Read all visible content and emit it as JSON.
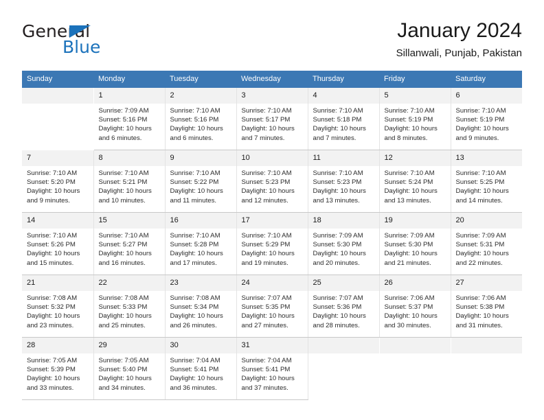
{
  "brand": {
    "name_dark": "General",
    "name_blue": "Blue",
    "accent_color": "#1b72bb"
  },
  "header": {
    "month_title": "January 2024",
    "location": "Sillanwali, Punjab, Pakistan"
  },
  "calendar": {
    "header_bg": "#3c78b4",
    "daynum_bg": "#f2f2f2",
    "weekdays": [
      "Sunday",
      "Monday",
      "Tuesday",
      "Wednesday",
      "Thursday",
      "Friday",
      "Saturday"
    ],
    "weeks": [
      [
        {
          "day": "",
          "sunrise": "",
          "sunset": "",
          "daylight_line1": "",
          "daylight_line2": "",
          "empty": true
        },
        {
          "day": "1",
          "sunrise": "Sunrise: 7:09 AM",
          "sunset": "Sunset: 5:16 PM",
          "daylight_line1": "Daylight: 10 hours",
          "daylight_line2": "and 6 minutes."
        },
        {
          "day": "2",
          "sunrise": "Sunrise: 7:10 AM",
          "sunset": "Sunset: 5:16 PM",
          "daylight_line1": "Daylight: 10 hours",
          "daylight_line2": "and 6 minutes."
        },
        {
          "day": "3",
          "sunrise": "Sunrise: 7:10 AM",
          "sunset": "Sunset: 5:17 PM",
          "daylight_line1": "Daylight: 10 hours",
          "daylight_line2": "and 7 minutes."
        },
        {
          "day": "4",
          "sunrise": "Sunrise: 7:10 AM",
          "sunset": "Sunset: 5:18 PM",
          "daylight_line1": "Daylight: 10 hours",
          "daylight_line2": "and 7 minutes."
        },
        {
          "day": "5",
          "sunrise": "Sunrise: 7:10 AM",
          "sunset": "Sunset: 5:19 PM",
          "daylight_line1": "Daylight: 10 hours",
          "daylight_line2": "and 8 minutes."
        },
        {
          "day": "6",
          "sunrise": "Sunrise: 7:10 AM",
          "sunset": "Sunset: 5:19 PM",
          "daylight_line1": "Daylight: 10 hours",
          "daylight_line2": "and 9 minutes."
        }
      ],
      [
        {
          "day": "7",
          "sunrise": "Sunrise: 7:10 AM",
          "sunset": "Sunset: 5:20 PM",
          "daylight_line1": "Daylight: 10 hours",
          "daylight_line2": "and 9 minutes."
        },
        {
          "day": "8",
          "sunrise": "Sunrise: 7:10 AM",
          "sunset": "Sunset: 5:21 PM",
          "daylight_line1": "Daylight: 10 hours",
          "daylight_line2": "and 10 minutes."
        },
        {
          "day": "9",
          "sunrise": "Sunrise: 7:10 AM",
          "sunset": "Sunset: 5:22 PM",
          "daylight_line1": "Daylight: 10 hours",
          "daylight_line2": "and 11 minutes."
        },
        {
          "day": "10",
          "sunrise": "Sunrise: 7:10 AM",
          "sunset": "Sunset: 5:23 PM",
          "daylight_line1": "Daylight: 10 hours",
          "daylight_line2": "and 12 minutes."
        },
        {
          "day": "11",
          "sunrise": "Sunrise: 7:10 AM",
          "sunset": "Sunset: 5:23 PM",
          "daylight_line1": "Daylight: 10 hours",
          "daylight_line2": "and 13 minutes."
        },
        {
          "day": "12",
          "sunrise": "Sunrise: 7:10 AM",
          "sunset": "Sunset: 5:24 PM",
          "daylight_line1": "Daylight: 10 hours",
          "daylight_line2": "and 13 minutes."
        },
        {
          "day": "13",
          "sunrise": "Sunrise: 7:10 AM",
          "sunset": "Sunset: 5:25 PM",
          "daylight_line1": "Daylight: 10 hours",
          "daylight_line2": "and 14 minutes."
        }
      ],
      [
        {
          "day": "14",
          "sunrise": "Sunrise: 7:10 AM",
          "sunset": "Sunset: 5:26 PM",
          "daylight_line1": "Daylight: 10 hours",
          "daylight_line2": "and 15 minutes."
        },
        {
          "day": "15",
          "sunrise": "Sunrise: 7:10 AM",
          "sunset": "Sunset: 5:27 PM",
          "daylight_line1": "Daylight: 10 hours",
          "daylight_line2": "and 16 minutes."
        },
        {
          "day": "16",
          "sunrise": "Sunrise: 7:10 AM",
          "sunset": "Sunset: 5:28 PM",
          "daylight_line1": "Daylight: 10 hours",
          "daylight_line2": "and 17 minutes."
        },
        {
          "day": "17",
          "sunrise": "Sunrise: 7:10 AM",
          "sunset": "Sunset: 5:29 PM",
          "daylight_line1": "Daylight: 10 hours",
          "daylight_line2": "and 19 minutes."
        },
        {
          "day": "18",
          "sunrise": "Sunrise: 7:09 AM",
          "sunset": "Sunset: 5:30 PM",
          "daylight_line1": "Daylight: 10 hours",
          "daylight_line2": "and 20 minutes."
        },
        {
          "day": "19",
          "sunrise": "Sunrise: 7:09 AM",
          "sunset": "Sunset: 5:30 PM",
          "daylight_line1": "Daylight: 10 hours",
          "daylight_line2": "and 21 minutes."
        },
        {
          "day": "20",
          "sunrise": "Sunrise: 7:09 AM",
          "sunset": "Sunset: 5:31 PM",
          "daylight_line1": "Daylight: 10 hours",
          "daylight_line2": "and 22 minutes."
        }
      ],
      [
        {
          "day": "21",
          "sunrise": "Sunrise: 7:08 AM",
          "sunset": "Sunset: 5:32 PM",
          "daylight_line1": "Daylight: 10 hours",
          "daylight_line2": "and 23 minutes."
        },
        {
          "day": "22",
          "sunrise": "Sunrise: 7:08 AM",
          "sunset": "Sunset: 5:33 PM",
          "daylight_line1": "Daylight: 10 hours",
          "daylight_line2": "and 25 minutes."
        },
        {
          "day": "23",
          "sunrise": "Sunrise: 7:08 AM",
          "sunset": "Sunset: 5:34 PM",
          "daylight_line1": "Daylight: 10 hours",
          "daylight_line2": "and 26 minutes."
        },
        {
          "day": "24",
          "sunrise": "Sunrise: 7:07 AM",
          "sunset": "Sunset: 5:35 PM",
          "daylight_line1": "Daylight: 10 hours",
          "daylight_line2": "and 27 minutes."
        },
        {
          "day": "25",
          "sunrise": "Sunrise: 7:07 AM",
          "sunset": "Sunset: 5:36 PM",
          "daylight_line1": "Daylight: 10 hours",
          "daylight_line2": "and 28 minutes."
        },
        {
          "day": "26",
          "sunrise": "Sunrise: 7:06 AM",
          "sunset": "Sunset: 5:37 PM",
          "daylight_line1": "Daylight: 10 hours",
          "daylight_line2": "and 30 minutes."
        },
        {
          "day": "27",
          "sunrise": "Sunrise: 7:06 AM",
          "sunset": "Sunset: 5:38 PM",
          "daylight_line1": "Daylight: 10 hours",
          "daylight_line2": "and 31 minutes."
        }
      ],
      [
        {
          "day": "28",
          "sunrise": "Sunrise: 7:05 AM",
          "sunset": "Sunset: 5:39 PM",
          "daylight_line1": "Daylight: 10 hours",
          "daylight_line2": "and 33 minutes."
        },
        {
          "day": "29",
          "sunrise": "Sunrise: 7:05 AM",
          "sunset": "Sunset: 5:40 PM",
          "daylight_line1": "Daylight: 10 hours",
          "daylight_line2": "and 34 minutes."
        },
        {
          "day": "30",
          "sunrise": "Sunrise: 7:04 AM",
          "sunset": "Sunset: 5:41 PM",
          "daylight_line1": "Daylight: 10 hours",
          "daylight_line2": "and 36 minutes."
        },
        {
          "day": "31",
          "sunrise": "Sunrise: 7:04 AM",
          "sunset": "Sunset: 5:41 PM",
          "daylight_line1": "Daylight: 10 hours",
          "daylight_line2": "and 37 minutes."
        },
        {
          "day": "",
          "sunrise": "",
          "sunset": "",
          "daylight_line1": "",
          "daylight_line2": "",
          "empty": true
        },
        {
          "day": "",
          "sunrise": "",
          "sunset": "",
          "daylight_line1": "",
          "daylight_line2": "",
          "empty": true
        },
        {
          "day": "",
          "sunrise": "",
          "sunset": "",
          "daylight_line1": "",
          "daylight_line2": "",
          "empty": true
        }
      ]
    ]
  }
}
